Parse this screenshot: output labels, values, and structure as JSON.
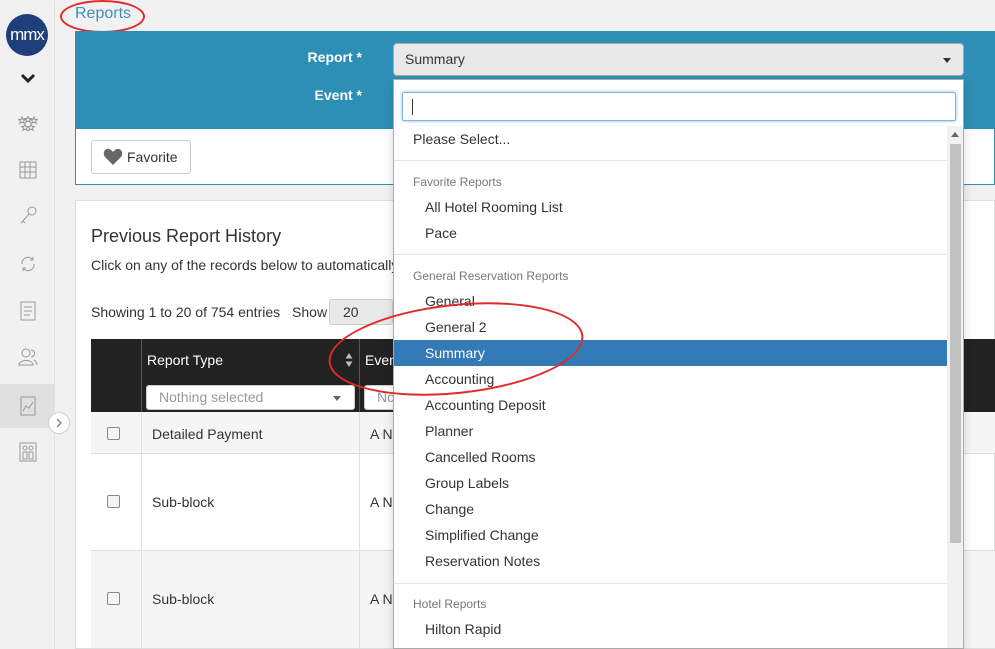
{
  "sidebar": {
    "logo": "mmx",
    "icons": [
      "stars-icon",
      "calendar-grid-icon",
      "key-icon",
      "sync-icon",
      "document-list-icon",
      "users-icon",
      "report-chart-icon",
      "elevator-icon"
    ]
  },
  "breadcrumb": {
    "label": "Reports"
  },
  "form": {
    "report_label": "Report *",
    "event_label": "Event *",
    "report_value": "Summary",
    "favorite_label": "Favorite"
  },
  "history": {
    "title": "Previous Report History",
    "subtitle": "Click on any of the records below to automatically",
    "showing_text": "Showing 1 to 20 of 754 entries",
    "show_label": "Show",
    "show_value": "20",
    "columns": [
      "Report Type",
      "Even"
    ],
    "filter_placeholder": "Nothing selected",
    "filter_placeholder_2": "No",
    "rows": [
      {
        "report_type": "Detailed Payment",
        "event": "A N"
      },
      {
        "report_type": "Sub-block",
        "event": "A N"
      },
      {
        "report_type": "Sub-block",
        "event": "A N"
      }
    ]
  },
  "dropdown": {
    "search_value": "",
    "please_select": "Please Select...",
    "groups": [
      {
        "label": "Favorite Reports",
        "items": [
          "All Hotel Rooming List",
          "Pace"
        ]
      },
      {
        "label": "General Reservation Reports",
        "items": [
          "General",
          "General 2",
          "Summary",
          "Accounting",
          "Accounting Deposit",
          "Planner",
          "Cancelled Rooms",
          "Group Labels",
          "Change",
          "Simplified Change",
          "Reservation Notes"
        ]
      },
      {
        "label": "Hotel Reports",
        "items": [
          "Hilton Rapid"
        ]
      }
    ],
    "selected": "Summary"
  },
  "colors": {
    "accent": "#2d8fb6",
    "selected": "#337ab7",
    "annotation": "#e02b2b",
    "header_dark": "#222222"
  }
}
